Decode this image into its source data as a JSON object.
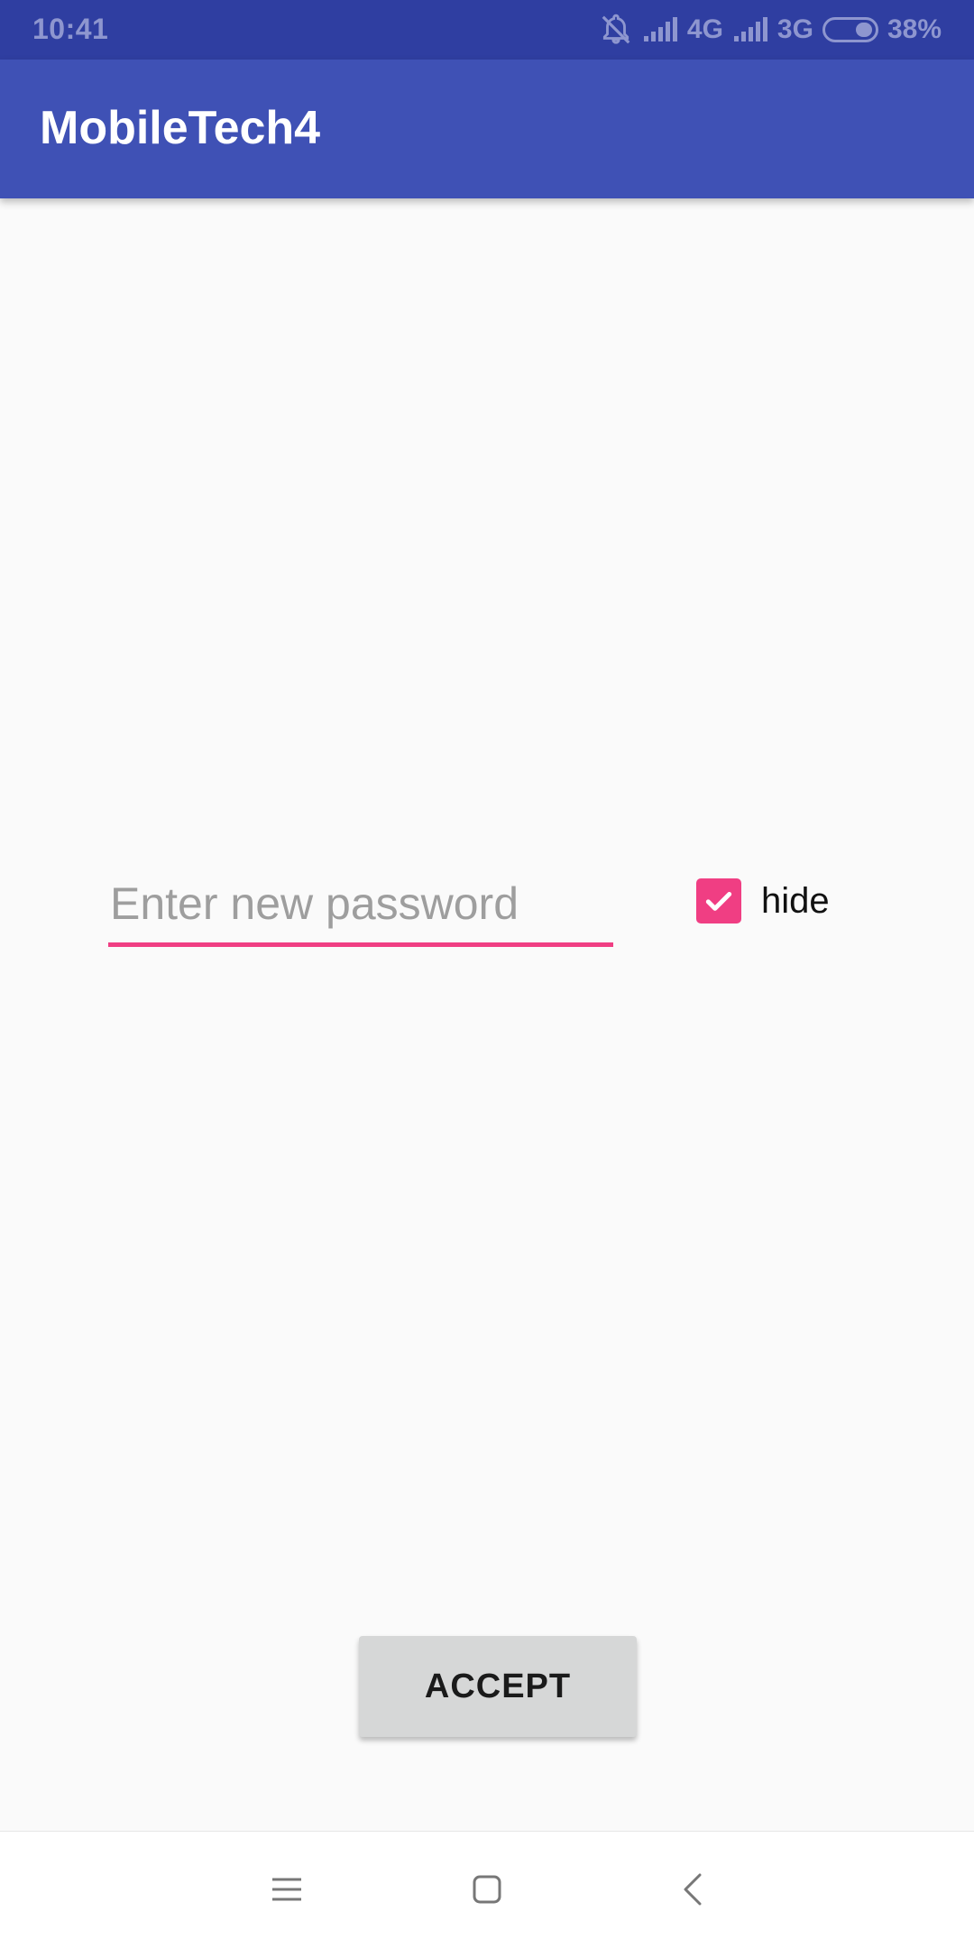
{
  "status_bar": {
    "time": "10:41",
    "network_primary": "4G",
    "network_secondary": "3G",
    "battery": "38%",
    "icons": [
      "notifications-off-icon",
      "signal-icon",
      "signal-icon",
      "battery-icon"
    ]
  },
  "app_bar": {
    "title": "MobileTech4"
  },
  "form": {
    "password_placeholder": "Enter new password",
    "password_value": "",
    "hide_label": "hide",
    "hide_checked": true,
    "accept_label": "ACCEPT"
  },
  "nav_bar": {
    "icons": [
      "menu-icon",
      "home-icon",
      "back-icon"
    ]
  },
  "colors": {
    "status_bar": "#2f3ea1",
    "app_bar": "#3f51b5",
    "accent": "#f03e83",
    "background": "#fafafa",
    "button": "#d6d7d7"
  }
}
